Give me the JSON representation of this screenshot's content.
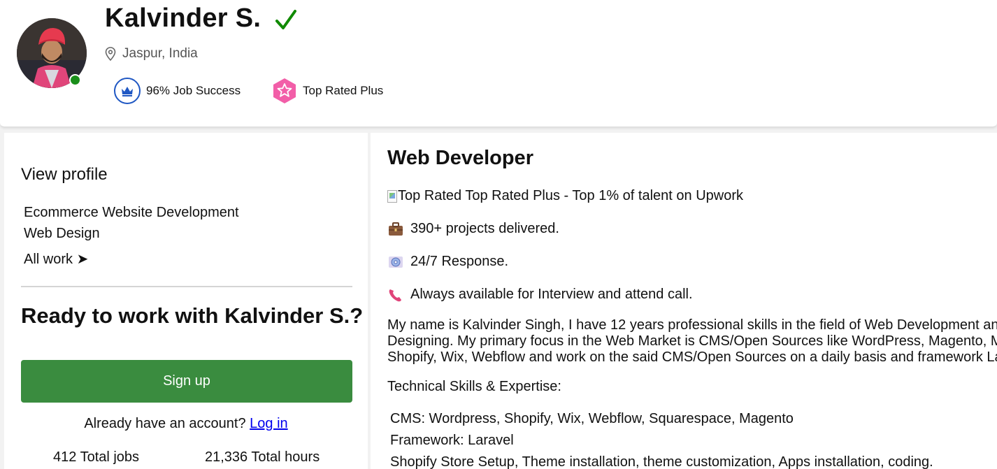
{
  "profile": {
    "name": "Kalvinder S.",
    "location": "Jaspur, India",
    "badges": {
      "job_success": "96% Job Success",
      "top_rated": "Top Rated Plus"
    }
  },
  "sidebar": {
    "view_profile": "View profile",
    "work_items": [
      "Ecommerce Website Development",
      "Web Design"
    ],
    "all_work": "All work ➤",
    "ready_title": "Ready to work with Kalvinder S.?",
    "signup": "Sign up",
    "account_prompt": "Already have an account?",
    "login": "Log in",
    "stats": {
      "total_jobs": "412 Total jobs",
      "total_hours": "21,336 Total hours"
    }
  },
  "main": {
    "title": "Web Developer",
    "top_rated_line": "Top Rated Top Rated Plus - Top 1% of talent on Upwork",
    "highlights": [
      "390+ projects delivered.",
      "24/7 Response.",
      "Always available for Interview and attend call."
    ],
    "bio_lines": [
      "My name is Kalvinder Singh, I have 12 years professional skills in the field of Web Development an",
      "Designing. My primary focus in the Web Market is CMS/Open Sources like WordPress, Magento, M",
      "Shopify, Wix, Webflow and work on the said CMS/Open Sources on a daily basis and framework La"
    ],
    "skills_heading": "Technical Skills & Expertise:",
    "skills": [
      "CMS: Wordpress, Shopify, Wix, Webflow, Squarespace, Magento",
      "Framework: Laravel",
      "Shopify Store Setup, Theme installation, theme customization, Apps installation, coding."
    ]
  },
  "colors": {
    "signup_button": "#3a8c3f",
    "verified": "#108a00",
    "online": "#1a8f1a",
    "job_success_ring": "#1f57c3",
    "top_rated_badge": "#f25ea8",
    "link": "#0000ee"
  },
  "icons": {
    "verified": "checkmark-icon",
    "location": "map-pin-icon",
    "job_success": "crown-badge-icon",
    "top_rated": "star-hexagon-icon",
    "projects": "briefcase-icon",
    "response": "dvd-icon",
    "call": "telephone-icon"
  }
}
